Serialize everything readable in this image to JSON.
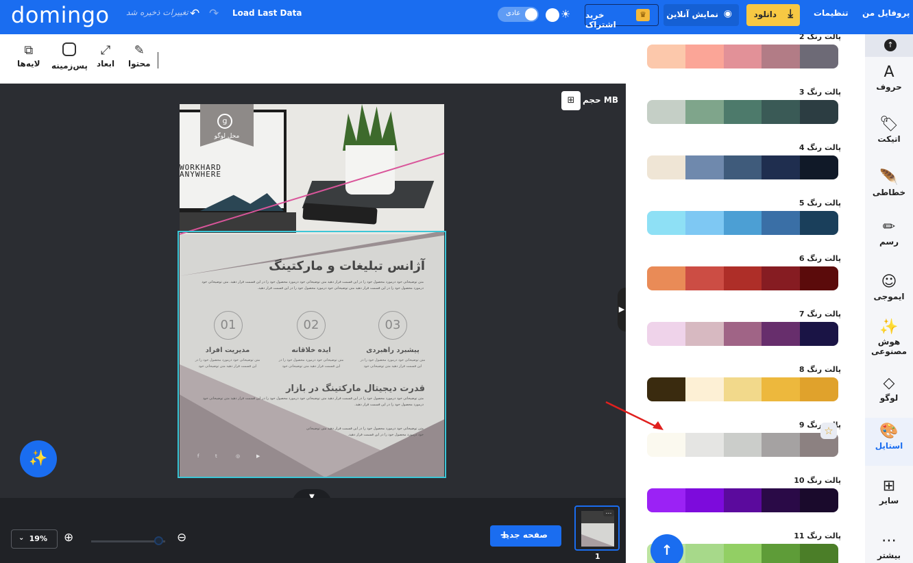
{
  "topbar": {
    "logo": "domingo",
    "unsaved_text": "تغییرات ذخیره شد",
    "undo_icon": "↶",
    "redo_icon": "↷",
    "load_last": "Load Last Data",
    "mode_label": "عادی",
    "sun_icon": "☀",
    "subscribe_label": "خرید اشتراک",
    "crown_icon": "♛",
    "online_label": "نمایش آنلاین",
    "eye_icon": "◉",
    "download_label": "دانلود",
    "download_icon": "⤓",
    "settings_label": "تنظیمات",
    "profile_label": "پروفایل من"
  },
  "toolbar": {
    "content_label": "محتوا",
    "content_icon": "✎",
    "dimensions_label": "ابعاد",
    "dimensions_icon": "⤢",
    "background_label": "پس‌زمینه",
    "layers_label": "لایه‌ها",
    "layers_icon": "⧉"
  },
  "canvas": {
    "size_label": "حجم MB",
    "calc_icon": "⊞",
    "logo_place": "محل لوگو",
    "logo_letter": "g",
    "work_line1": "WORKHARD",
    "work_line2": "ANYWHERE",
    "title": "آژانس تبلیغات و مارکتینگ",
    "paragraph": "متن توضیحاتی خود درمورد محصول خود را در این قسمت قرار دهید متن توضیحاتی خود درمورد محصول خود را در این قسمت قرار دهید. متن توضیحاتی خود درمورد محصول خود را در این قسمت قرار دهید متن توضیحاتی خود درمورد محصول خود را در این قسمت قرار دهید.",
    "num1": "01",
    "num2": "02",
    "num3": "03",
    "col1_title": "مدیریت افراد",
    "col2_title": "ایده خلاقانه",
    "col3_title": "پیشبرد راهبردی",
    "col_text": "متن توضیحاتی خود درمورد محصول خود را در این قسمت قرار دهید متن توضیحاتی خود",
    "sub_title": "قدرت دیجیتال مارکتینگ در بازار",
    "sub_para1": "متن توضیحاتی خود درمورد محصول خود را در این قسمت قرار دهید متن توضیحاتی خود درمورد محصول خود را در این قسمت قرار دهید متن توضیحاتی خود درمورد محصول خود را در این قسمت قرار دهید.",
    "sub_para2": "متن توضیحاتی خود درمورد محصول خود را در این قسمت قرار دهید متن توضیحاتی خود درمورد محصول خود را در این قسمت قرار دهید.",
    "social_f": "f",
    "social_t": "t",
    "social_i": "◎",
    "social_y": "▶",
    "side_handle_icon": "▶",
    "down_handle_icon": "▼",
    "magic_icon": "✨"
  },
  "bottombar": {
    "zoom_value": "19%",
    "zoom_chevron": "⌄",
    "zoom_in_icon": "⊕",
    "zoom_out_icon": "⊖",
    "zoom_level": 0.92,
    "new_page_label": "صفحه جدید",
    "new_page_icon": "+",
    "thumb_dots": "…",
    "page_number": "1"
  },
  "palettes": [
    {
      "label": "پالت رنگ 2",
      "colors": [
        "#fcc8ab",
        "#fba597",
        "#e29198",
        "#b27c86",
        "#6d6a76"
      ]
    },
    {
      "label": "پالت رنگ 3",
      "colors": [
        "#c5cfc6",
        "#7fa58b",
        "#4d7a6b",
        "#3a5a56",
        "#2c3d42"
      ]
    },
    {
      "label": "پالت رنگ 4",
      "colors": [
        "#efe5d5",
        "#6f89ad",
        "#3f5b7b",
        "#1f2e4f",
        "#101928"
      ]
    },
    {
      "label": "پالت رنگ 5",
      "colors": [
        "#8ee0f5",
        "#7ec8f3",
        "#4c9fd4",
        "#3a6fa6",
        "#1a3f5b"
      ]
    },
    {
      "label": "پالت رنگ 6",
      "colors": [
        "#e98b57",
        "#cc4d44",
        "#ae2e28",
        "#861c22",
        "#5b0b0b"
      ]
    },
    {
      "label": "پالت رنگ 7",
      "colors": [
        "#efd3ea",
        "#d7b9c1",
        "#a06486",
        "#672e6c",
        "#1a1445"
      ]
    },
    {
      "label": "پالت رنگ 8",
      "colors": [
        "#3a2b0f",
        "#fdf0d5",
        "#f2d98b",
        "#edb83d",
        "#e0a22c"
      ]
    },
    {
      "label": "پالت رنگ 9",
      "colors": [
        "#fbf9ef",
        "#e5e5e3",
        "#cbcdca",
        "#a5a2a2",
        "#8c8181"
      ]
    },
    {
      "label": "پالت رنگ 10",
      "colors": [
        "#9b22f5",
        "#7d0bdc",
        "#5b0a9d",
        "#2a0a47",
        "#1a0a2c"
      ]
    },
    {
      "label": "پالت رنگ 11",
      "colors": [
        "#bde4a1",
        "#a7d98a",
        "#92cf64",
        "#5e9c38",
        "#4b7e28"
      ]
    }
  ],
  "panel": {
    "star_icon": "☆",
    "fab_icon": "↑"
  },
  "sidebar": {
    "top_icon": "↑",
    "items": [
      {
        "label": "حروف",
        "icon": "A"
      },
      {
        "label": "اتیکت",
        "icon": "🏷"
      },
      {
        "label": "خطاطی",
        "icon": "🪶"
      },
      {
        "label": "رسم",
        "icon": "✏"
      },
      {
        "label": "ایموجی",
        "icon": "☺"
      },
      {
        "label": "هوش مصنوعی",
        "icon": "✨"
      },
      {
        "label": "لوگو",
        "icon": "◇"
      },
      {
        "label": "استایل",
        "icon": "🎨"
      },
      {
        "label": "سایر",
        "icon": "⊞"
      },
      {
        "label": "بیشتر",
        "icon": "⋯"
      }
    ],
    "active_index": 7
  },
  "colors": {
    "brand_blue": "#1a6df0",
    "selection": "#3cc6d7",
    "download_yellow": "#f7c843",
    "annotation_arrow": "#e0201e"
  }
}
